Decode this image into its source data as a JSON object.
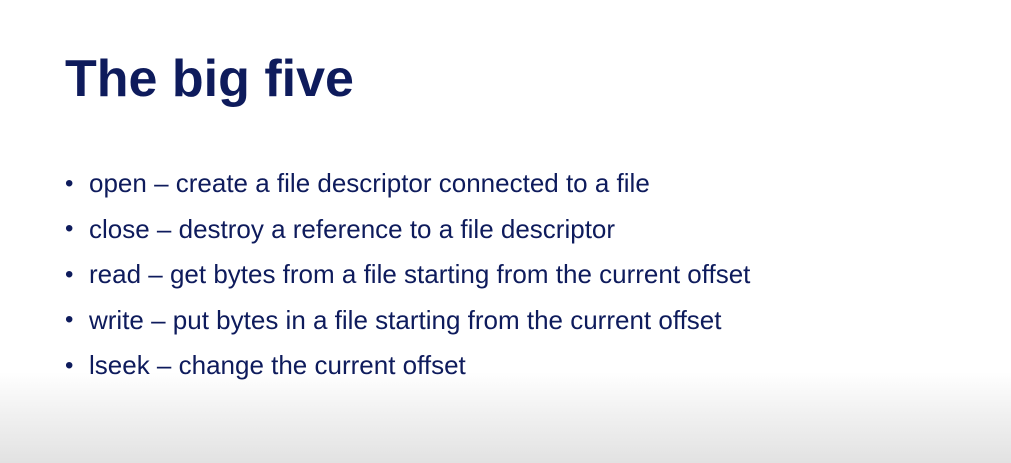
{
  "slide": {
    "title": "The big five",
    "bullets": [
      "open – create a file descriptor connected to a file",
      "close – destroy a reference to a file descriptor",
      "read – get bytes from a file starting from the current offset",
      "write – put bytes in a file starting from the current offset",
      "lseek – change the current offset"
    ],
    "bullet_glyph": "•",
    "colors": {
      "text": "#0e1b5c",
      "background": "#ffffff"
    }
  }
}
